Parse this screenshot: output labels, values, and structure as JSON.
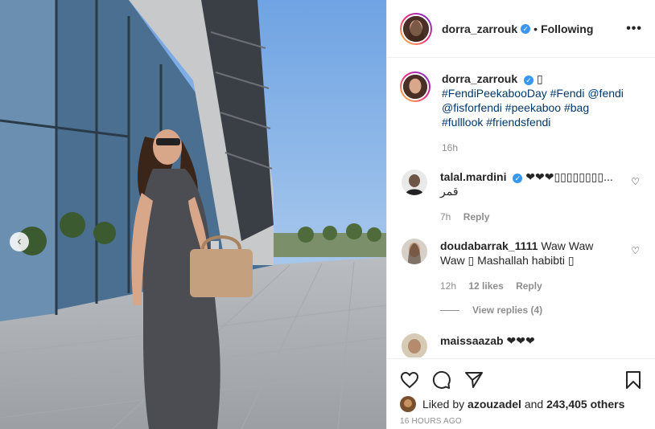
{
  "post": {
    "author": "dorra_zarrouk",
    "follow_separator": "•",
    "follow_status": "Following",
    "more_icon": "more-options-icon",
    "verified_icon": "verified-badge-icon"
  },
  "caption": {
    "username": "dorra_zarrouk",
    "emoji": "▯",
    "hashtags_line1": "#FendiPeekabooDay #Fendi @fendi",
    "hashtags_line2": "@fisforfendi #peekaboo #bag",
    "hashtags_line3": "#fulllook #friendsfendi",
    "time": "16h"
  },
  "comments": [
    {
      "username": "talal.mardini",
      "text_line1": "❤❤❤▯▯▯▯▯▯▯▯...",
      "text_line2": "قمر",
      "time": "7h",
      "reply": "Reply"
    },
    {
      "username": "doudabarrak_1111",
      "text": "Waw Waw Waw ▯ Mashallah habibti ▯",
      "time": "12h",
      "likes": "12 likes",
      "reply": "Reply",
      "view_replies": "View replies (4)"
    },
    {
      "username": "maissaazab",
      "text": "❤❤❤"
    }
  ],
  "footer": {
    "liked_prefix": "Liked by",
    "liked_user": "azouzadel",
    "liked_and": "and",
    "liked_count": "243,405 others",
    "time_ago": "16 HOURS AGO"
  },
  "colors": {
    "link": "#00376b",
    "verified": "#3897f0",
    "muted": "#8e8e8e",
    "text": "#262626"
  }
}
